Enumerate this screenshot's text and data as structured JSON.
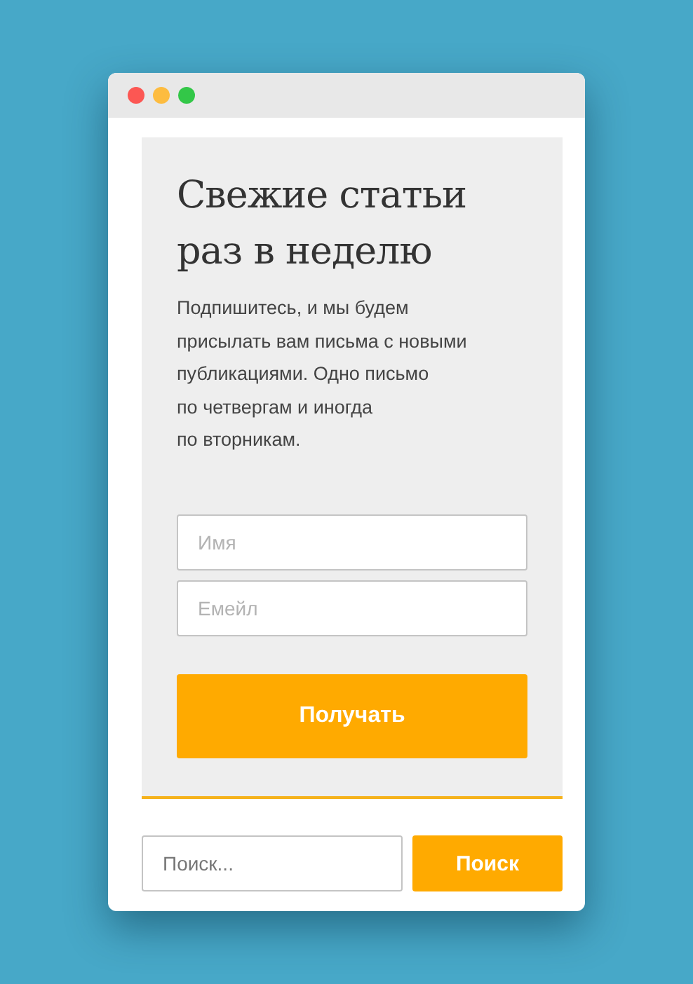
{
  "window": {
    "controls": [
      {
        "color": "#fc5753"
      },
      {
        "color": "#fdbc40"
      },
      {
        "color": "#33c748"
      }
    ]
  },
  "subscribe": {
    "title": "Свежие статьи раз в неделю",
    "text": "Подпишитесь, и мы будем\nприсылать вам письма с новыми\nпубликациями. Одно письмо\nпо четвергам и иногда\nпо вторникам.",
    "fields": [
      {
        "placeholder": "Имя"
      },
      {
        "placeholder": "Емейл"
      }
    ],
    "button": "Получать"
  },
  "search": {
    "placeholder": "Поиск...",
    "button": "Поиск"
  }
}
